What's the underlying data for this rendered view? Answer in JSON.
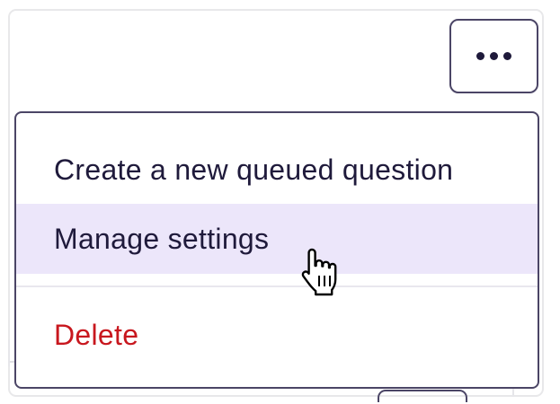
{
  "toolbar": {
    "more_button_icon": "more-horizontal-icon"
  },
  "menu": {
    "items": [
      {
        "label": "Create a new queued question",
        "state": "default"
      },
      {
        "label": "Manage settings",
        "state": "hover"
      },
      {
        "label": "Delete",
        "state": "destructive"
      }
    ]
  },
  "colors": {
    "text": "#1f1a3b",
    "border": "#4b4566",
    "hover_bg": "#ece6fa",
    "danger": "#c8171e"
  },
  "cursor": {
    "icon": "hand-pointer-icon"
  }
}
